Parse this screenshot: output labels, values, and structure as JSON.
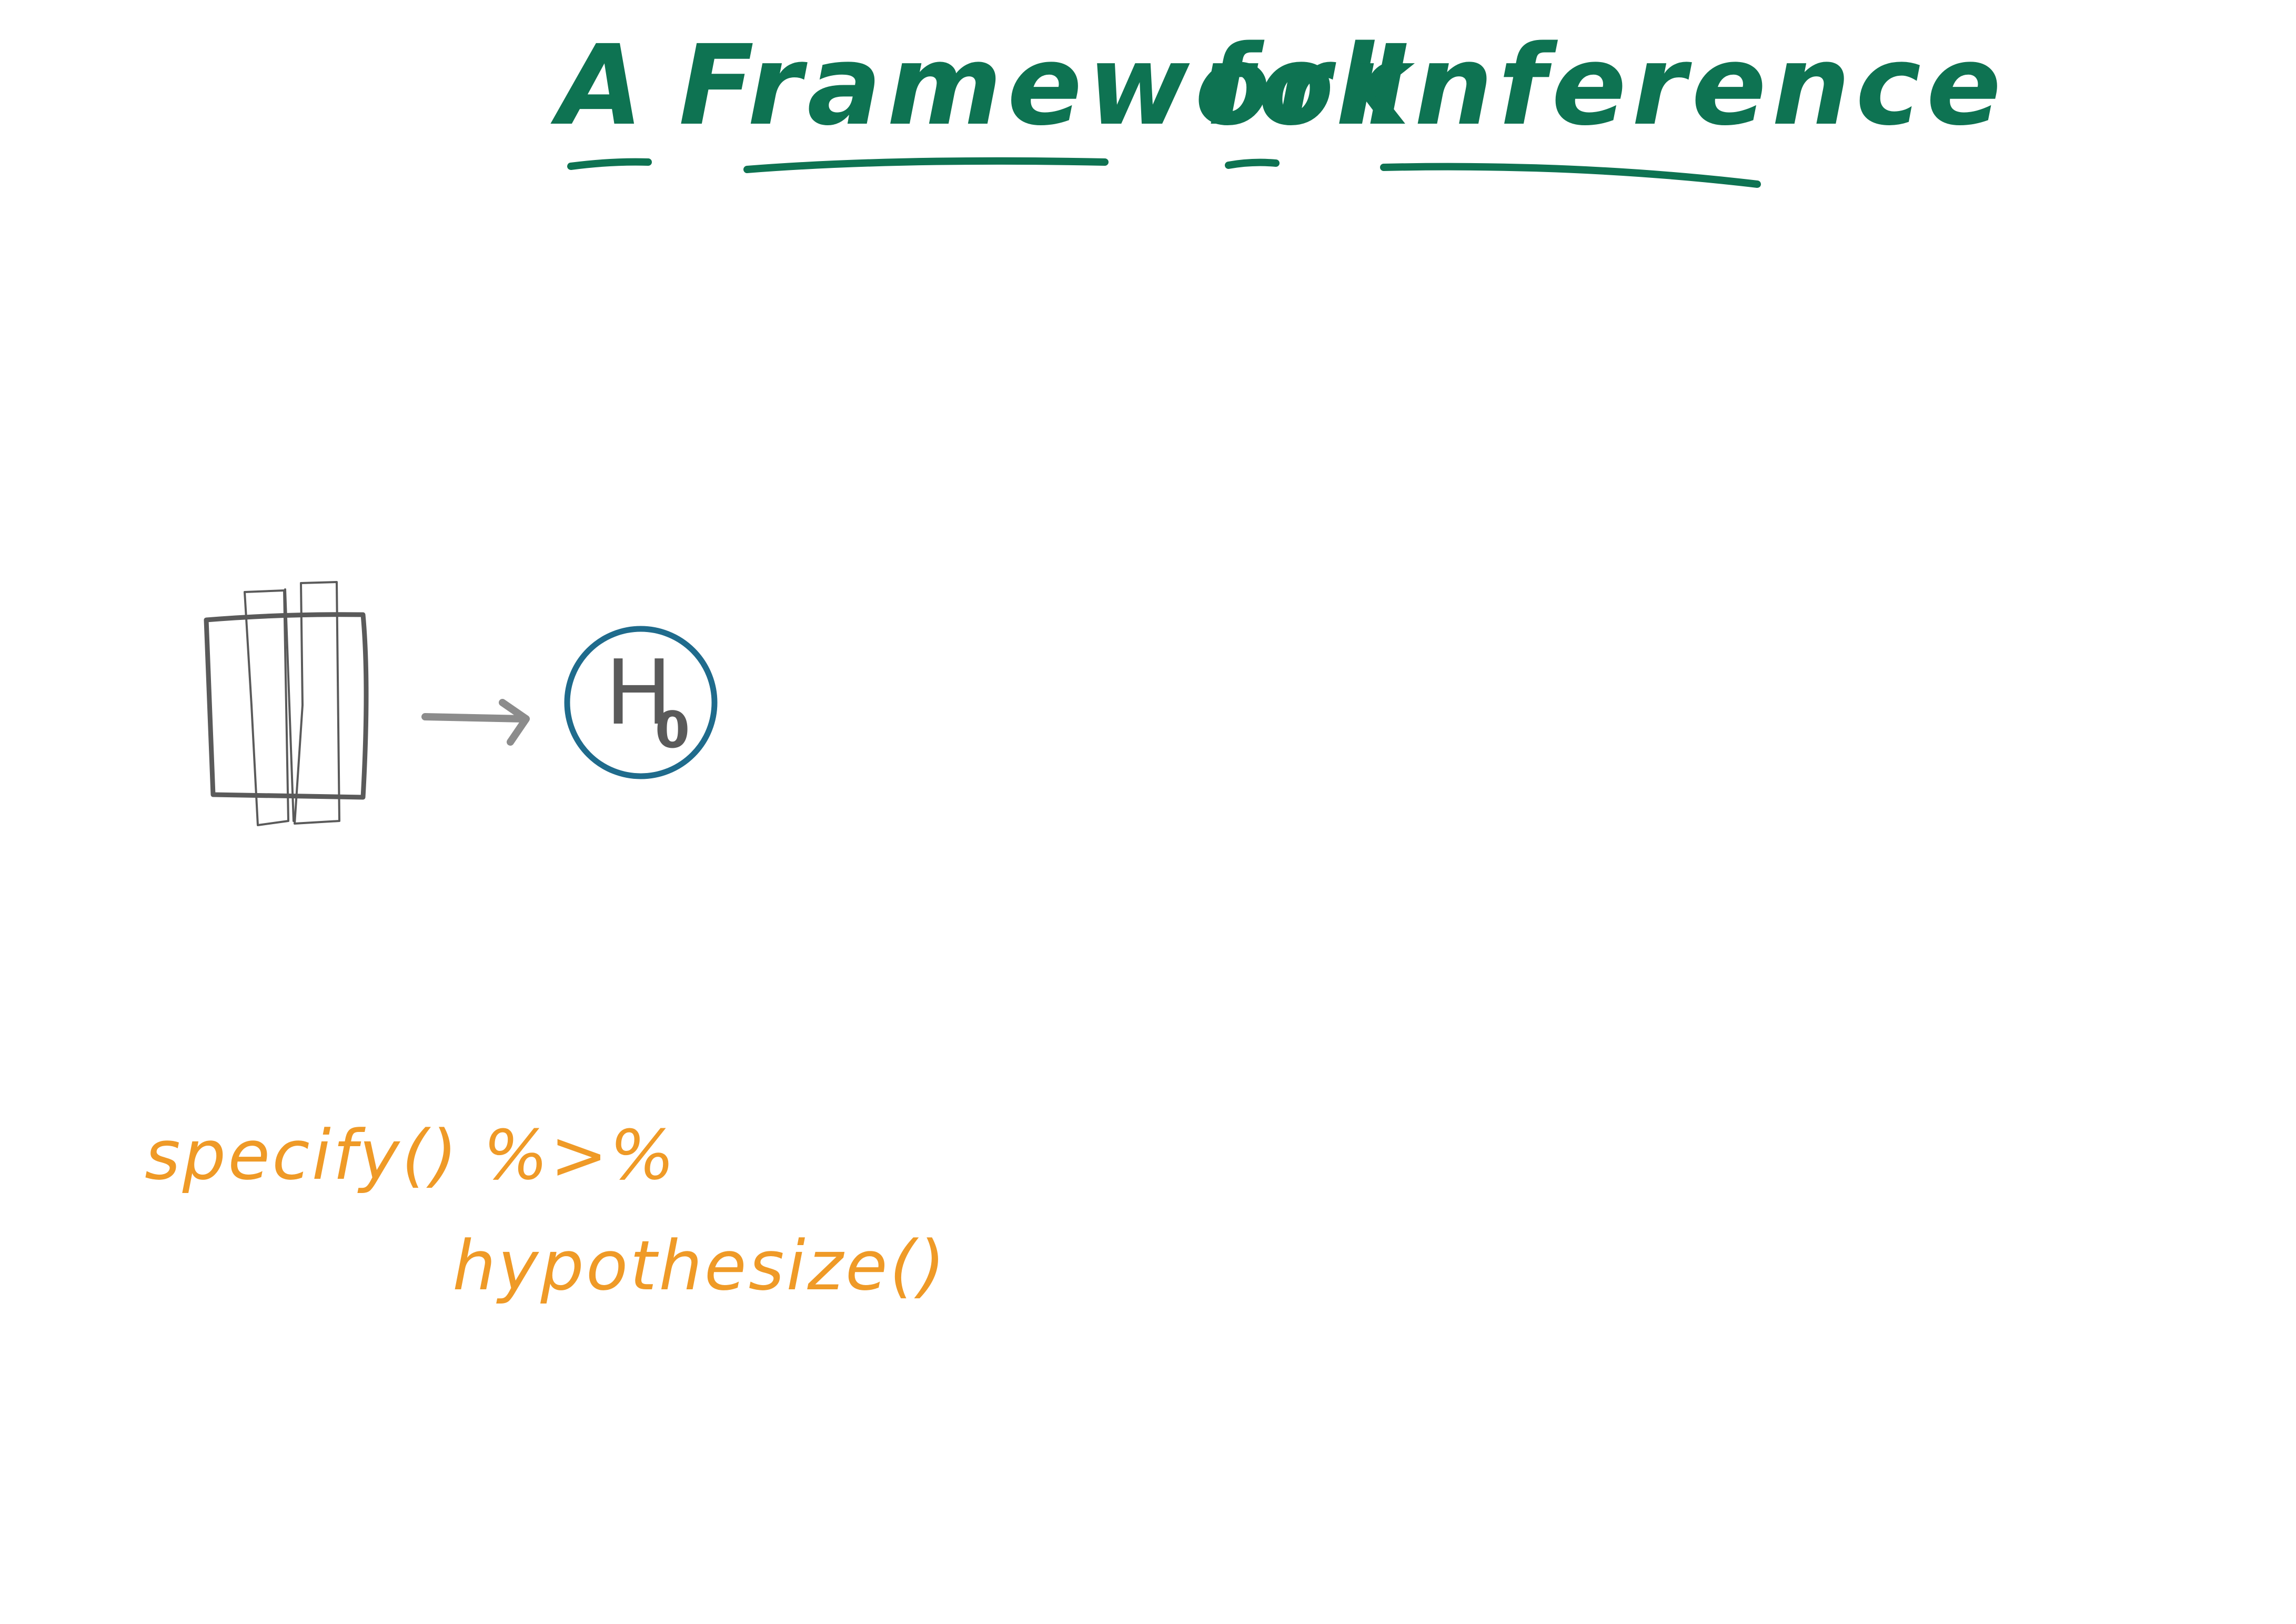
{
  "title": {
    "words": [
      "A",
      "Framework",
      "for",
      "Inference"
    ]
  },
  "hypothesis_node": {
    "main": "H",
    "subscript": "0"
  },
  "code": {
    "line1": "specify() %>%",
    "line2": "hypothesize()"
  },
  "colors": {
    "title": "#0e7352",
    "data_table": "#5a5a5a",
    "arrow": "#8c8c8c",
    "circle": "#1f6b8c",
    "code": "#ef9a27"
  }
}
